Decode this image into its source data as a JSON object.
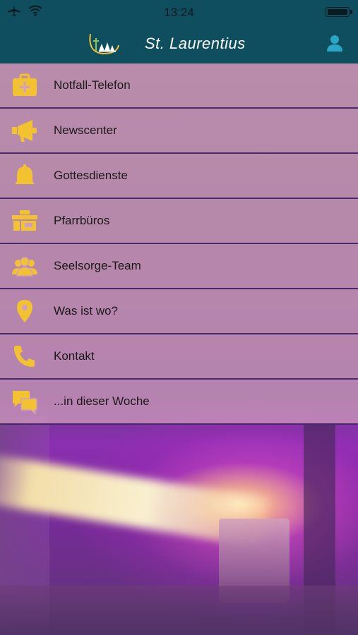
{
  "status_bar": {
    "time": "13:24",
    "icons": [
      "airplane-icon",
      "wifi-icon",
      "battery-icon"
    ]
  },
  "header": {
    "title": "St. Laurentius",
    "logo": "church-logo",
    "right_icon": "user-icon"
  },
  "menu": {
    "items": [
      {
        "label": "Notfall-Telefon",
        "icon": "first-aid-kit-icon"
      },
      {
        "label": "Newscenter",
        "icon": "megaphone-icon"
      },
      {
        "label": "Gottesdienste",
        "icon": "bell-icon"
      },
      {
        "label": "Pfarrbüros",
        "icon": "office-icon"
      },
      {
        "label": "Seelsorge-Team",
        "icon": "team-icon"
      },
      {
        "label": "Was ist wo?",
        "icon": "location-pin-icon"
      },
      {
        "label": "Kontakt",
        "icon": "phone-icon"
      },
      {
        "label": "...in dieser Woche",
        "icon": "chat-bubbles-icon"
      }
    ]
  },
  "colors": {
    "bar": "#0f4e5e",
    "accent_icon": "#f2c230",
    "menu_bg": "#d2a0be",
    "divider": "#4a2a6a"
  }
}
